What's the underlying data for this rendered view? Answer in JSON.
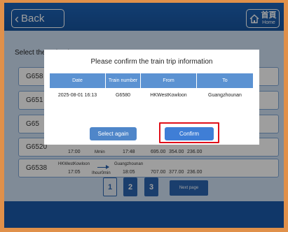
{
  "header": {
    "back_label": "Back",
    "home_label_zh": "首頁",
    "home_label_en": "Home"
  },
  "select_label": "Select the train trip：",
  "trips": [
    {
      "code": "G658"
    },
    {
      "code": "G651"
    },
    {
      "code": "G65"
    },
    {
      "code": "G6520",
      "depart_time": "17:00",
      "duration": "Mmin",
      "arrive_time": "17:48",
      "prices": [
        "695.00",
        "354.00",
        "236.00"
      ]
    },
    {
      "code": "G6538",
      "from": "HKWestKowloon",
      "to": "Guangzhounan",
      "depart_time": "17:05",
      "duration": "Ihour0min",
      "arrive_time": "18:05",
      "prices": [
        "707.00",
        "377.00",
        "236.00"
      ]
    }
  ],
  "pagination": {
    "pages": [
      "1",
      "2",
      "3"
    ],
    "active_page": "1",
    "next_label": "Next page"
  },
  "dialog": {
    "title": "Please confirm the train trip information",
    "columns": [
      "Date",
      "Train number",
      "From",
      "To"
    ],
    "row": [
      "2025-08-01 16:13",
      "G6580",
      "HKWestKowloon",
      "Guangzhounan"
    ],
    "select_again_label": "Select again",
    "confirm_label": "Confirm"
  },
  "colors": {
    "brand_blue": "#1e64b8",
    "table_header": "#5b92d2",
    "highlight": "#e0101a"
  }
}
